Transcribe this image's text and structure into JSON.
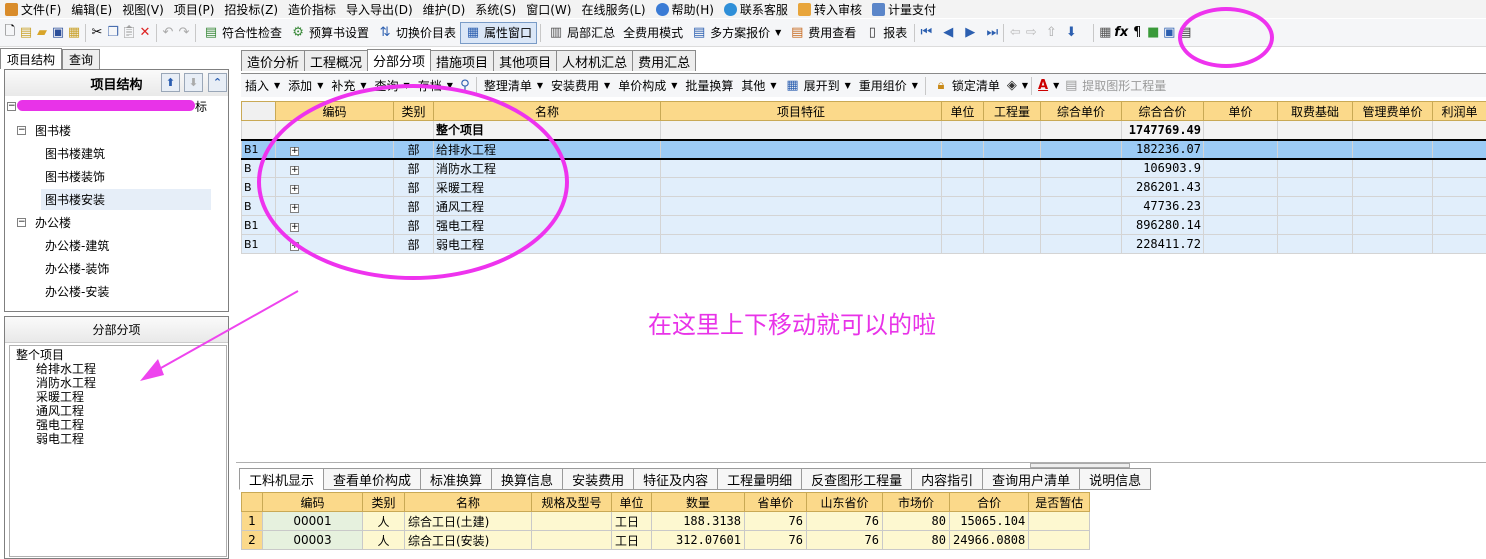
{
  "menubar": {
    "items": [
      "文件(F)",
      "编辑(E)",
      "视图(V)",
      "项目(P)",
      "招投标(Z)",
      "造价指标",
      "导入导出(D)",
      "维护(D)",
      "系统(S)",
      "窗口(W)",
      "在线服务(L)",
      "帮助(H)",
      "联系客服",
      "转入审核",
      "计量支付"
    ]
  },
  "toolbar": {
    "items": [
      "符合性检查",
      "预算书设置",
      "切换价目表",
      "属性窗口",
      "局部汇总",
      "全费用模式",
      "多方案报价",
      "费用查看",
      "报表"
    ]
  },
  "left_tabs": [
    "项目结构",
    "查询"
  ],
  "project_tree": {
    "title": "项目结构",
    "root": "标",
    "nodes": [
      {
        "label": "图书楼",
        "children": [
          "图书楼建筑",
          "图书楼装饰",
          "图书楼安装"
        ]
      },
      {
        "label": "办公楼",
        "children": [
          "办公楼-建筑",
          "办公楼-装饰",
          "办公楼-安装"
        ]
      }
    ]
  },
  "fenbu_panel": {
    "title": "分部分项",
    "root": "整个项目",
    "items": [
      "给排水工程",
      "消防水工程",
      "采暖工程",
      "通风工程",
      "强电工程",
      "弱电工程"
    ]
  },
  "main_tabs": [
    "造价分析",
    "工程概况",
    "分部分项",
    "措施项目",
    "其他项目",
    "人材机汇总",
    "费用汇总"
  ],
  "sub_toolbar": {
    "items": [
      "插入",
      "添加",
      "补充",
      "查询",
      "存档",
      "整理清单",
      "安装费用",
      "单价构成",
      "批量换算",
      "其他",
      "展开到",
      "重用组价",
      "锁定清单",
      "提取图形工程量"
    ]
  },
  "main_grid": {
    "headers": [
      "编码",
      "类别",
      "名称",
      "项目特征",
      "单位",
      "工程量",
      "综合单价",
      "综合合价",
      "单价",
      "取费基础",
      "管理费单价",
      "利润单"
    ],
    "total": {
      "name": "整个项目",
      "amount": "1747769.49"
    },
    "rows": [
      {
        "rh": "B1",
        "type": "部",
        "name": "给排水工程",
        "amount": "182236.07"
      },
      {
        "rh": "B",
        "type": "部",
        "name": "消防水工程",
        "amount": "106903.9"
      },
      {
        "rh": "B",
        "type": "部",
        "name": "采暖工程",
        "amount": "286201.43"
      },
      {
        "rh": "B",
        "type": "部",
        "name": "通风工程",
        "amount": "47736.23"
      },
      {
        "rh": "B1",
        "type": "部",
        "name": "强电工程",
        "amount": "896280.14"
      },
      {
        "rh": "B1",
        "type": "部",
        "name": "弱电工程",
        "amount": "228411.72"
      }
    ]
  },
  "annotation": "在这里上下移动就可以的啦",
  "lower_tabs": [
    "工料机显示",
    "查看单价构成",
    "标准换算",
    "换算信息",
    "安装费用",
    "特征及内容",
    "工程量明细",
    "反查图形工程量",
    "内容指引",
    "查询用户清单",
    "说明信息"
  ],
  "lower_grid": {
    "headers": [
      "编码",
      "类别",
      "名称",
      "规格及型号",
      "单位",
      "数量",
      "省单价",
      "山东省价",
      "市场价",
      "合价",
      "是否暂估"
    ],
    "rows": [
      [
        "1",
        "00001",
        "人",
        "综合工日(土建)",
        "",
        "工日",
        "188.3138",
        "76",
        "76",
        "80",
        "15065.104"
      ],
      [
        "2",
        "00003",
        "人",
        "综合工日(安装)",
        "",
        "工日",
        "312.07601",
        "76",
        "76",
        "80",
        "24966.0808"
      ]
    ]
  },
  "colors": {
    "annotation": "#e833e8",
    "header": "#fbd98a",
    "selected": "#9ccbf5"
  }
}
